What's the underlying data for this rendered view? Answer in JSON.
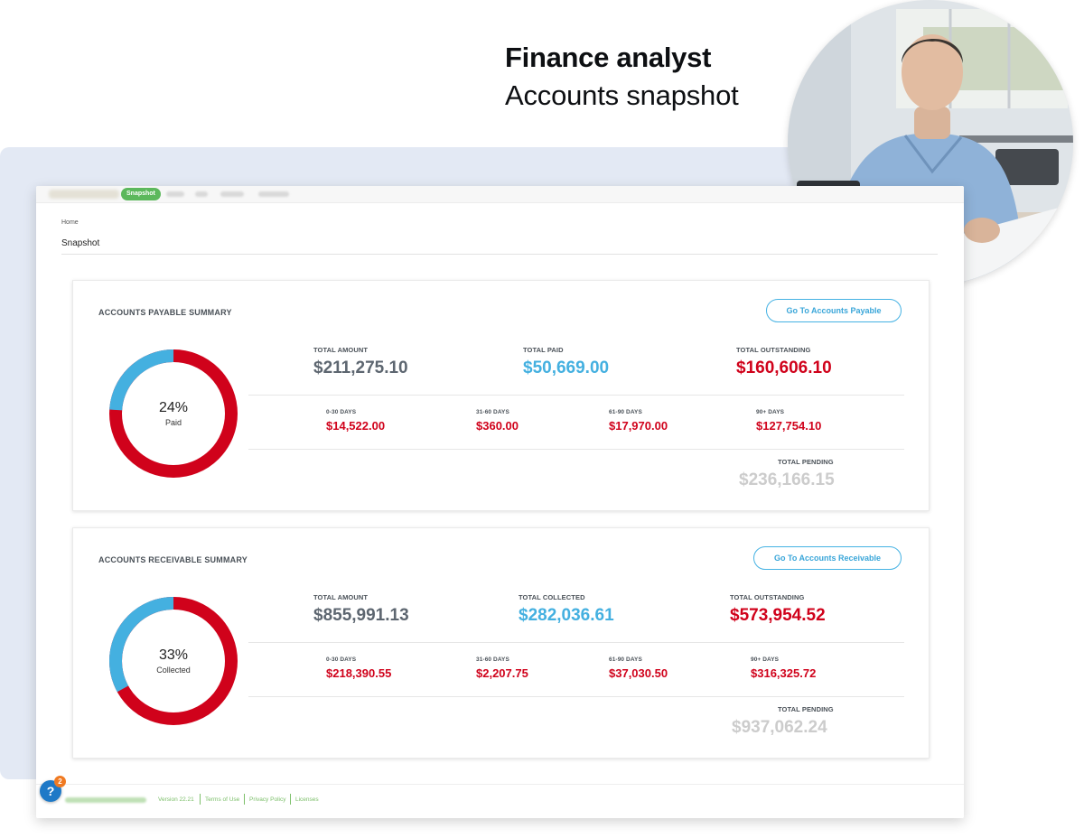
{
  "hero": {
    "title": "Finance analyst",
    "subtitle": "Accounts snapshot"
  },
  "nav": {
    "active_tab": "Snapshot"
  },
  "page": {
    "breadcrumb": "Home",
    "title": "Snapshot"
  },
  "payable": {
    "title": "ACCOUNTS PAYABLE SUMMARY",
    "button": "Go To Accounts Payable",
    "donut": {
      "percent": "24%",
      "label": "Paid",
      "fraction": 0.24
    },
    "total_amount_label": "TOTAL AMOUNT",
    "total_amount": "$211,275.10",
    "total_paid_label": "TOTAL PAID",
    "total_paid": "$50,669.00",
    "total_outstanding_label": "TOTAL OUTSTANDING",
    "total_outstanding": "$160,606.10",
    "aging": [
      {
        "label": "0-30 DAYS",
        "value": "$14,522.00"
      },
      {
        "label": "31-60 DAYS",
        "value": "$360.00"
      },
      {
        "label": "61-90 DAYS",
        "value": "$17,970.00"
      },
      {
        "label": "90+ DAYS",
        "value": "$127,754.10"
      }
    ],
    "pending_label": "TOTAL PENDING",
    "pending": "$236,166.15"
  },
  "receivable": {
    "title": "ACCOUNTS RECEIVABLE SUMMARY",
    "button": "Go To Accounts Receivable",
    "donut": {
      "percent": "33%",
      "label": "Collected",
      "fraction": 0.33
    },
    "total_amount_label": "TOTAL AMOUNT",
    "total_amount": "$855,991.13",
    "total_collected_label": "TOTAL COLLECTED",
    "total_collected": "$282,036.61",
    "total_outstanding_label": "TOTAL OUTSTANDING",
    "total_outstanding": "$573,954.52",
    "aging": [
      {
        "label": "0-30 DAYS",
        "value": "$218,390.55"
      },
      {
        "label": "31-60 DAYS",
        "value": "$2,207.75"
      },
      {
        "label": "61-90 DAYS",
        "value": "$37,030.50"
      },
      {
        "label": "90+ DAYS",
        "value": "$316,325.72"
      }
    ],
    "pending_label": "TOTAL PENDING",
    "pending": "$937,062.24"
  },
  "footer": {
    "version": "Version 22.21",
    "links": [
      "Terms of Use",
      "Privacy Policy",
      "Licenses"
    ]
  },
  "help": {
    "icon": "?",
    "badge": "2"
  },
  "colors": {
    "accent_blue": "#44b0e0",
    "red": "#d0021b",
    "green": "#5cb85c",
    "help_blue": "#1e79c7",
    "badge_orange": "#f07a22"
  }
}
